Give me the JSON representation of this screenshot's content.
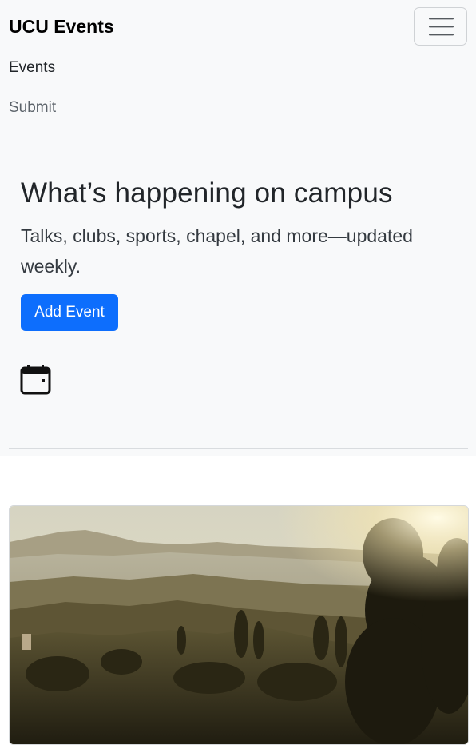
{
  "navbar": {
    "brand": "UCU Events",
    "links": [
      {
        "label": "Events"
      },
      {
        "label": "Submit"
      }
    ]
  },
  "hero": {
    "title": "What’s happening on campus",
    "subtitle": "Talks, clubs, sports, chapel, and more—updated weekly.",
    "cta_label": "Add Event"
  },
  "icons": {
    "menu": "hamburger-icon",
    "calendar": "calendar-icon"
  },
  "colors": {
    "primary": "#0d6efd",
    "hero_bg": "#f8f9fa"
  }
}
